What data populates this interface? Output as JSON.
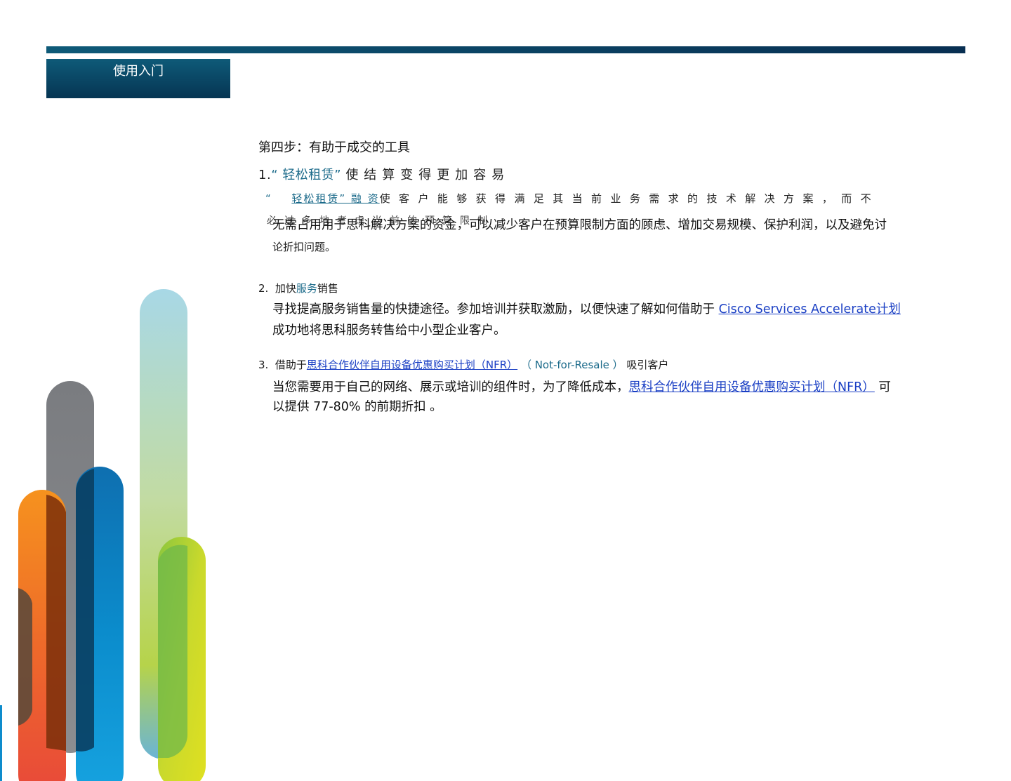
{
  "header": {
    "tab_label": "使用入门"
  },
  "colors": {
    "bar_start": "#0e5a78",
    "bar_end": "#082f52",
    "accent_teal": "#1b6a8a",
    "link_blue": "#1a3fc4"
  },
  "step": {
    "title": "第四步：有助于成交的工具"
  },
  "section1": {
    "number": "1.",
    "quote_open": "“",
    "highlight": "轻松租赁",
    "quote_close": "”",
    "rest": "使结算变得更加容易",
    "overlap_line1_prefix": "“",
    "overlap_line1_link": "轻松租赁” 融 资",
    "overlap_line1_rest": "使客户能够获得满足其当前业务需求的技术解决方案，而不",
    "overlap_line2_ghost": "必过多地考虑当前的预算限制",
    "overlap_line2": "无需占用用于思科解决方案的资金，可以减少客户在预算限制方面的顾虑、增加交易规模、保护利润，以及避免讨",
    "overlap_line3": "论折扣问题。"
  },
  "section2": {
    "number": "2.",
    "prefix": "加快",
    "highlight": "服务",
    "suffix": "销售",
    "body_line1_text": "寻找提高服务销售量的快捷途径。参加培训并获取激励，以便快速了解如何借助于 ",
    "body_line1_link": "Cisco Services Accelerate计划",
    "body_line2": "成功地将思科服务转售给中小型企业客户。"
  },
  "section3": {
    "number": "3.",
    "prefix": "借助于",
    "link": "思科合作伙伴自用设备优惠购买计划（NFR）",
    "paren": "（ Not-for-Resale ）",
    "suffix": "吸引客户",
    "body_line1_text": "当您需要用于自己的网络、展示或培训的组件时，为了降低成本，",
    "body_line1_link": "思科合作伙伴自用设备优惠购买计划（NFR）",
    "body_line1_tail": "可",
    "body_line2": "以提供 77-80% 的前期折扣 。"
  }
}
